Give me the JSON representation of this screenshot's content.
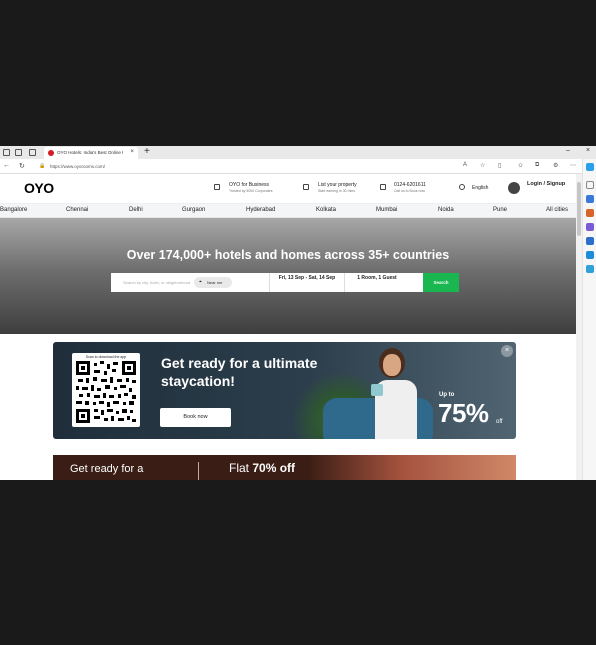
{
  "browser": {
    "tab_title": "OYO Hotels: India's Best Online Hotel...",
    "tab_close": "×",
    "new_tab": "+",
    "url": "https://www.oyorooms.com/",
    "nav_back": "←",
    "nav_reload": "↻",
    "win_min": "‒",
    "win_max": "□",
    "win_close": "×"
  },
  "header": {
    "logo": "OYO",
    "items": [
      {
        "title": "OYO for Business",
        "sub": "Trusted by 5000 Corporates"
      },
      {
        "title": "List your property",
        "sub": "Start earning in 30 mins"
      },
      {
        "title": "0124-6201611",
        "sub": "Call us to Book now"
      },
      {
        "title": "English",
        "sub": ""
      }
    ],
    "login": "Login / Signup"
  },
  "cities": [
    "Bangalore",
    "Chennai",
    "Delhi",
    "Gurgaon",
    "Hyderabad",
    "Kolkata",
    "Mumbai",
    "Noida",
    "Pune",
    "All cities"
  ],
  "hero": {
    "headline": "Over 174,000+ hotels and homes across 35+ countries",
    "search_placeholder": "Search by city, hotel, or neighborhood",
    "near_me": "Near me",
    "dates": "Fri, 13 Sep - Sat, 14 Sep",
    "guests": "1 Room, 1 Guest",
    "search_button": "Search"
  },
  "banner1": {
    "qr_caption": "Scan to download the app",
    "title": "Get ready for a ultimate staycation!",
    "button": "Book now",
    "upto": "Up to",
    "percent": "75%",
    "off": "off",
    "close": "×"
  },
  "banner2": {
    "left": "Get ready for a",
    "right_prefix": "Flat ",
    "right_bold": "70% off"
  },
  "colors": {
    "brand_red": "#d71920",
    "search_green": "#1ab64f"
  }
}
